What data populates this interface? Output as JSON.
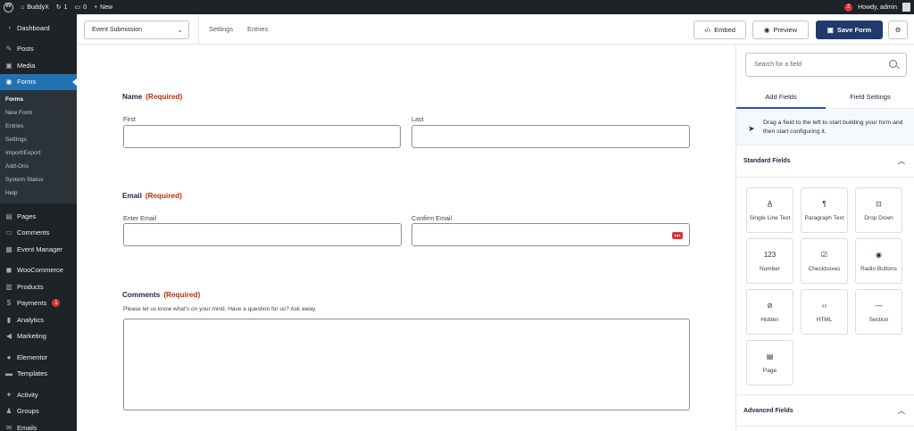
{
  "adminbar": {
    "site_name": "BuddyX",
    "updates_count": "1",
    "comments_count": "0",
    "new_label": "New",
    "notification_count": "2",
    "greeting": "Howdy, admin"
  },
  "sidebar": {
    "items_top": [
      {
        "label": "Dashboard",
        "icon": "dashboard-icon",
        "glyph": "◔"
      },
      {
        "label": "Posts",
        "icon": "pin-icon",
        "glyph": "✎"
      },
      {
        "label": "Media",
        "icon": "media-icon",
        "glyph": "▣"
      },
      {
        "label": "Forms",
        "icon": "forms-icon",
        "glyph": "◉"
      }
    ],
    "forms_submenu": [
      "Forms",
      "New Form",
      "Entries",
      "Settings",
      "Import/Export",
      "Add-Ons",
      "System Status",
      "Help"
    ],
    "items_bottom": [
      {
        "label": "Pages",
        "icon": "pages-icon",
        "glyph": "▤"
      },
      {
        "label": "Comments",
        "icon": "comments-icon",
        "glyph": "▭"
      },
      {
        "label": "Event Manager",
        "icon": "calendar-icon",
        "glyph": "▦"
      },
      {
        "label": "WooCommerce",
        "icon": "woocommerce-icon",
        "glyph": "◼"
      },
      {
        "label": "Products",
        "icon": "products-icon",
        "glyph": "▥"
      },
      {
        "label": "Payments",
        "icon": "payments-icon",
        "glyph": "$",
        "badge": "1"
      },
      {
        "label": "Analytics",
        "icon": "analytics-icon",
        "glyph": "▮"
      },
      {
        "label": "Marketing",
        "icon": "marketing-icon",
        "glyph": "◀"
      },
      {
        "label": "Elementor",
        "icon": "elementor-icon",
        "glyph": "●"
      },
      {
        "label": "Templates",
        "icon": "templates-icon",
        "glyph": "▬"
      },
      {
        "label": "Activity",
        "icon": "activity-icon",
        "glyph": "✦"
      },
      {
        "label": "Groups",
        "icon": "groups-icon",
        "glyph": "♟"
      },
      {
        "label": "Emails",
        "icon": "emails-icon",
        "glyph": "✉"
      }
    ]
  },
  "toolbar": {
    "form_name": "Event Submission",
    "settings_label": "Settings",
    "entries_label": "Entries",
    "embed_label": "Embed",
    "preview_label": "Preview",
    "save_label": "Save Form"
  },
  "form": {
    "name": {
      "label": "Name",
      "required": "(Required)",
      "first": "First",
      "last": "Last"
    },
    "email": {
      "label": "Email",
      "required": "(Required)",
      "enter": "Enter Email",
      "confirm": "Confirm Email"
    },
    "comments": {
      "label": "Comments",
      "required": "(Required)",
      "description": "Please let us know what's on your mind. Have a question for us? Ask away."
    }
  },
  "panel": {
    "search_placeholder": "Search for a field",
    "tab_add": "Add Fields",
    "tab_settings": "Field Settings",
    "hint": "Drag a field to the left to start building your form and then start configuring it.",
    "standard_title": "Standard Fields",
    "advanced_title": "Advanced Fields",
    "standard_fields": [
      {
        "label": "Single Line Text",
        "glyph": "A̲"
      },
      {
        "label": "Paragraph Text",
        "glyph": "¶"
      },
      {
        "label": "Drop Down",
        "glyph": "⊡"
      },
      {
        "label": "Number",
        "glyph": "123"
      },
      {
        "label": "Checkboxes",
        "glyph": "☑"
      },
      {
        "label": "Radio Buttons",
        "glyph": "◉"
      },
      {
        "label": "Hidden",
        "glyph": "⊘"
      },
      {
        "label": "HTML",
        "glyph": "‹›"
      },
      {
        "label": "Section",
        "glyph": "—"
      },
      {
        "label": "Page",
        "glyph": "▤"
      }
    ]
  }
}
